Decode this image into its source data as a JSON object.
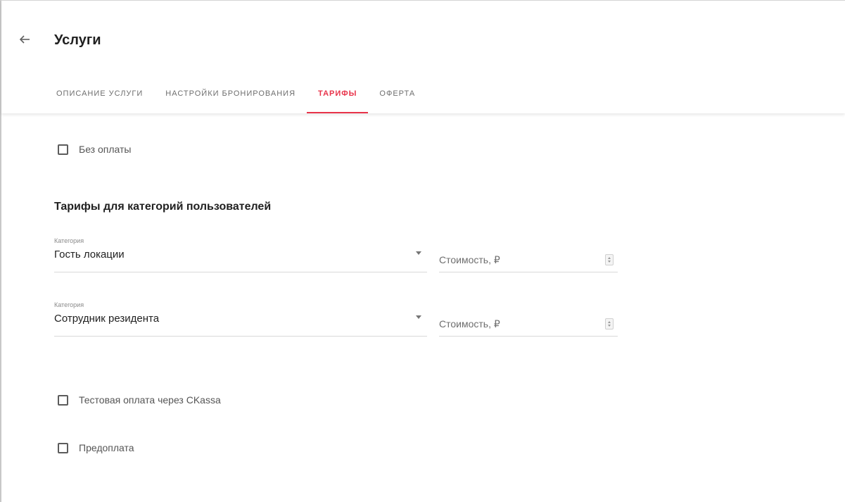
{
  "header": {
    "title": "Услуги",
    "back_icon": "arrow-left-icon"
  },
  "tabs": [
    {
      "label": "Описание услуги",
      "active": false
    },
    {
      "label": "Настройки бронирования",
      "active": false
    },
    {
      "label": "Тарифы",
      "active": true
    },
    {
      "label": "Оферта",
      "active": false
    }
  ],
  "colors": {
    "accent": "#e8334a",
    "text": "#212121",
    "muted": "#6e6e6e"
  },
  "no_payment": {
    "label": "Без оплаты",
    "checked": false
  },
  "section": {
    "title": "Тарифы для категорий пользователей"
  },
  "tariffs": [
    {
      "category_label": "Категория",
      "category_value": "Гость локации",
      "cost_placeholder": "Стоимость, ₽"
    },
    {
      "category_label": "Категория",
      "category_value": "Сотрудник резидента",
      "cost_placeholder": "Стоимость, ₽"
    }
  ],
  "test_payment": {
    "label": "Тестовая оплата через CKassa",
    "checked": false
  },
  "prepayment": {
    "label": "Предоплата",
    "checked": false
  }
}
